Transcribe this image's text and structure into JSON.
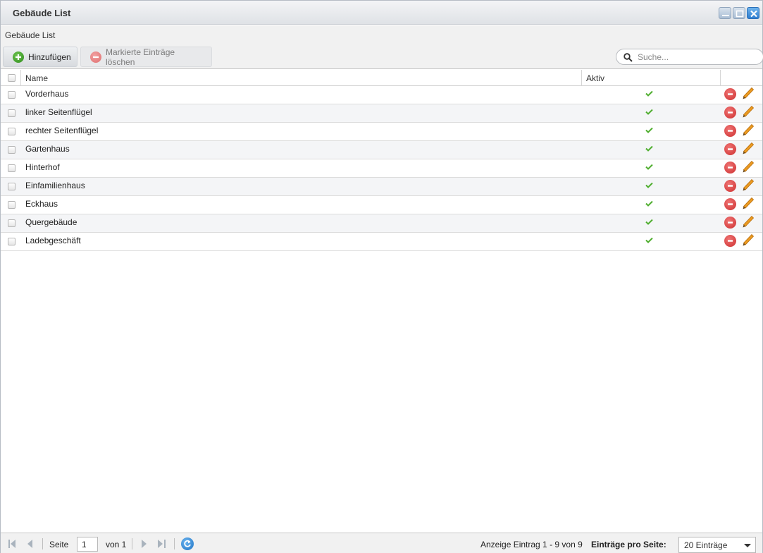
{
  "window": {
    "title": "Gebäude List",
    "controls": [
      "minimize-icon",
      "maximize-icon",
      "close-icon"
    ]
  },
  "panel": {
    "title": "Gebäude List"
  },
  "toolbar": {
    "add_label": "Hinzufügen",
    "delete_label": "Markierte Einträge löschen"
  },
  "search": {
    "placeholder": "Suche...",
    "value": ""
  },
  "table": {
    "columns": [
      "Name",
      "Aktiv"
    ],
    "rows": [
      {
        "name": "Vorderhaus",
        "aktiv": true
      },
      {
        "name": "linker Seitenflügel",
        "aktiv": true
      },
      {
        "name": "rechter Seitenflügel",
        "aktiv": true
      },
      {
        "name": "Gartenhaus",
        "aktiv": true
      },
      {
        "name": "Hinterhof",
        "aktiv": true
      },
      {
        "name": "Einfamilienhaus",
        "aktiv": true
      },
      {
        "name": "Eckhaus",
        "aktiv": true
      },
      {
        "name": "Quergebäude",
        "aktiv": true
      },
      {
        "name": "Ladebgeschäft",
        "aktiv": true
      }
    ]
  },
  "pager": {
    "page_label": "Seite",
    "page_value": "1",
    "of_label": "von 1",
    "display_info": "Anzeige Eintrag 1 - 9 von 9",
    "per_page_label": "Einträge pro Seite:",
    "per_page_value": "20 Einträge"
  },
  "colors": {
    "add_green": "#3a9a2a",
    "delete_red": "#d93a3a",
    "edit_orange": "#e8931e",
    "check_green": "#4fae2f",
    "close_blue": "#2f7ed0"
  }
}
